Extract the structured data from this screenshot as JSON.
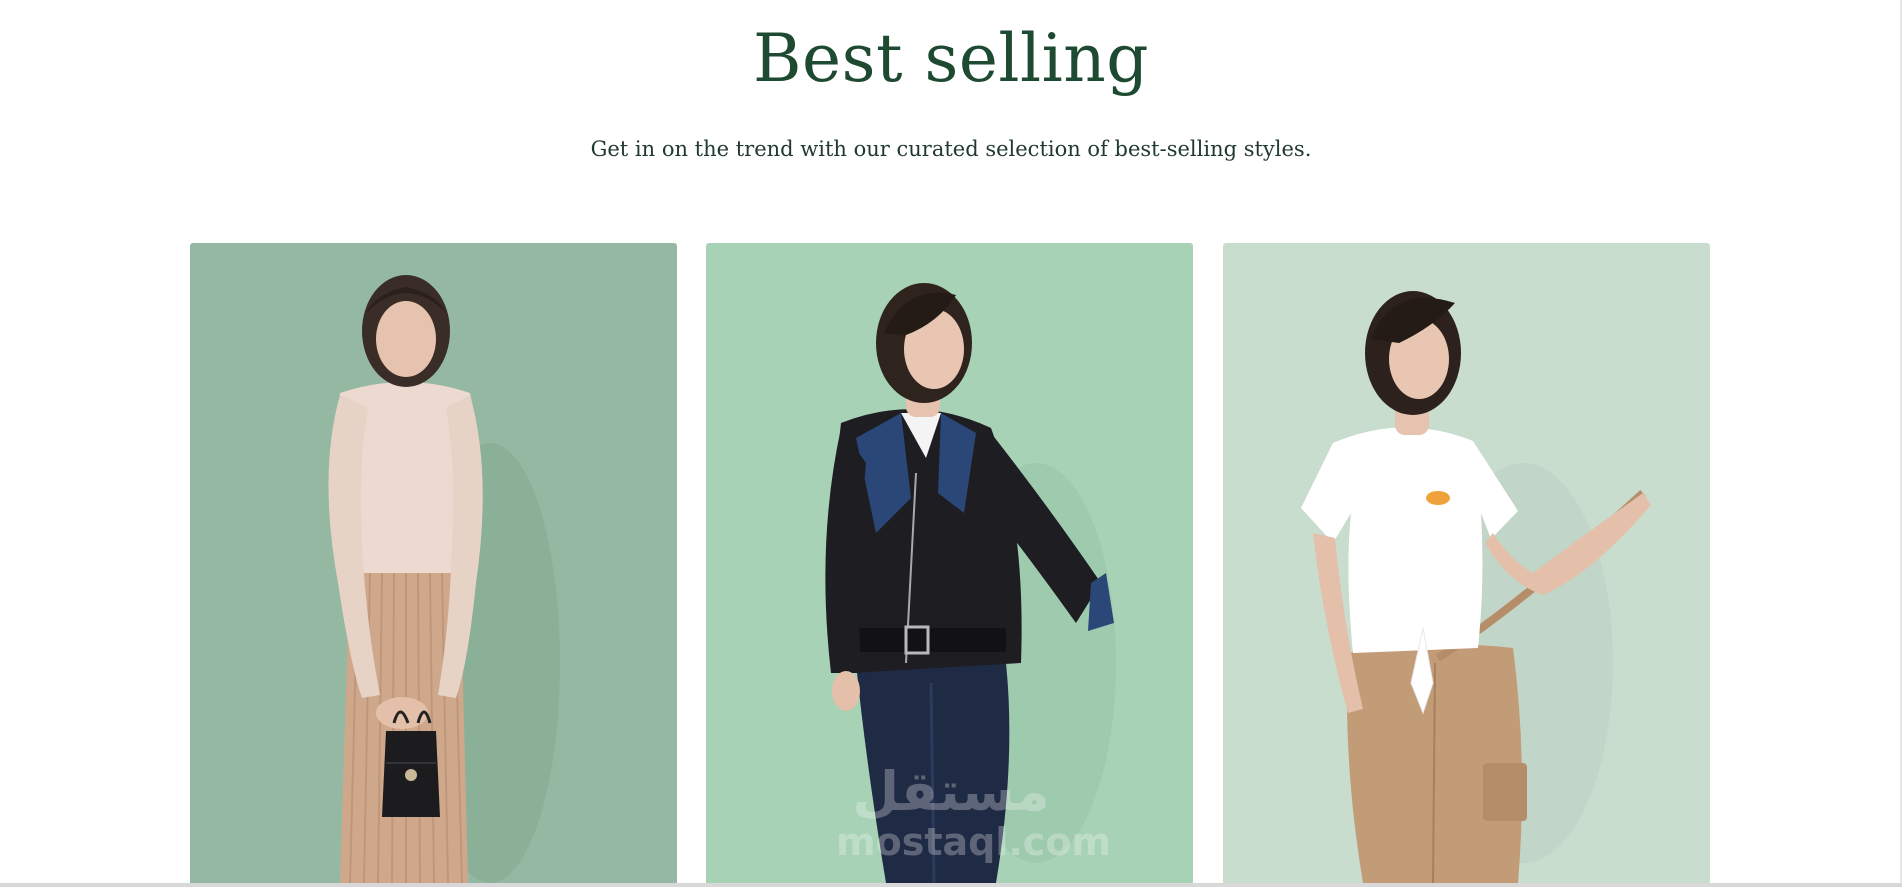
{
  "section": {
    "title": "Best selling",
    "subtitle": "Get in on the trend with our curated selection of best-selling styles."
  },
  "colors": {
    "title": "#1f4a32",
    "subtitle": "#213a2e",
    "card1_bg": "#94b8a1",
    "card2_bg": "#a7d2b6",
    "card3_bg": "#c9ddcf"
  },
  "products": [
    {
      "image": "model-turtleneck-pleated-skirt-handbag"
    },
    {
      "image": "model-leather-jacket-jeans"
    },
    {
      "image": "model-white-tee-cargo-pants"
    }
  ],
  "watermark": {
    "arabic": "مستقل",
    "latin": "mostaql.com"
  }
}
